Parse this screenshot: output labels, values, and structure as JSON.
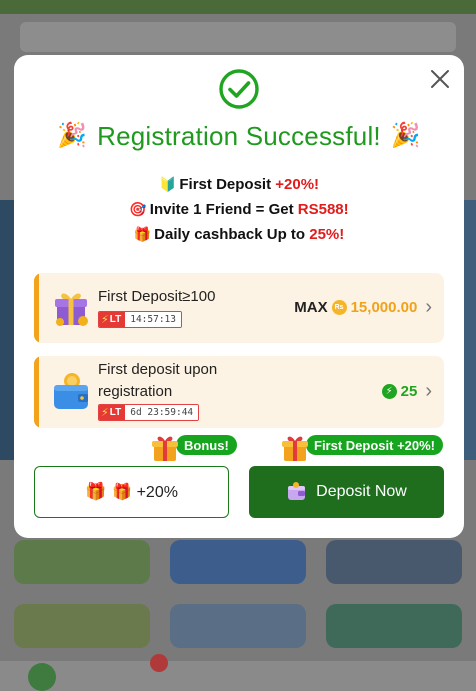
{
  "modal": {
    "title": "Registration Successful!",
    "perks": [
      {
        "icon": "🔰",
        "pre": "First Deposit ",
        "highlight": "+20%!",
        "post": ""
      },
      {
        "icon": "🎯",
        "pre": "Invite 1 Friend = Get ",
        "highlight": "RS588!",
        "post": ""
      },
      {
        "icon": "🎁",
        "pre": "Daily cashback Up to ",
        "highlight": "25%!",
        "post": ""
      }
    ],
    "offers": [
      {
        "title": "First Deposit≥100",
        "timer_badge": "LT",
        "timer": "14:57:13",
        "right_prefix": "MAX",
        "coin_symbol": "Rs",
        "right_value": "15,000.00",
        "icon": "gift-box-icon"
      },
      {
        "title": "First deposit upon registration",
        "timer_badge": "LT",
        "timer": "6d 23:59:44",
        "right_value": "25",
        "icon": "wallet-icon"
      }
    ],
    "tags": {
      "left": "Bonus!",
      "right": "First Deposit +20%!"
    },
    "buttons": {
      "secondary_label": "🎁 +20%",
      "primary_label": "Deposit Now"
    }
  },
  "colors": {
    "title_green": "#1f9a1f",
    "highlight_red": "#e21b1b",
    "card_bg": "#fdf3e4",
    "accent_orange": "#f3a31b",
    "primary_button": "#1e6e1e"
  }
}
